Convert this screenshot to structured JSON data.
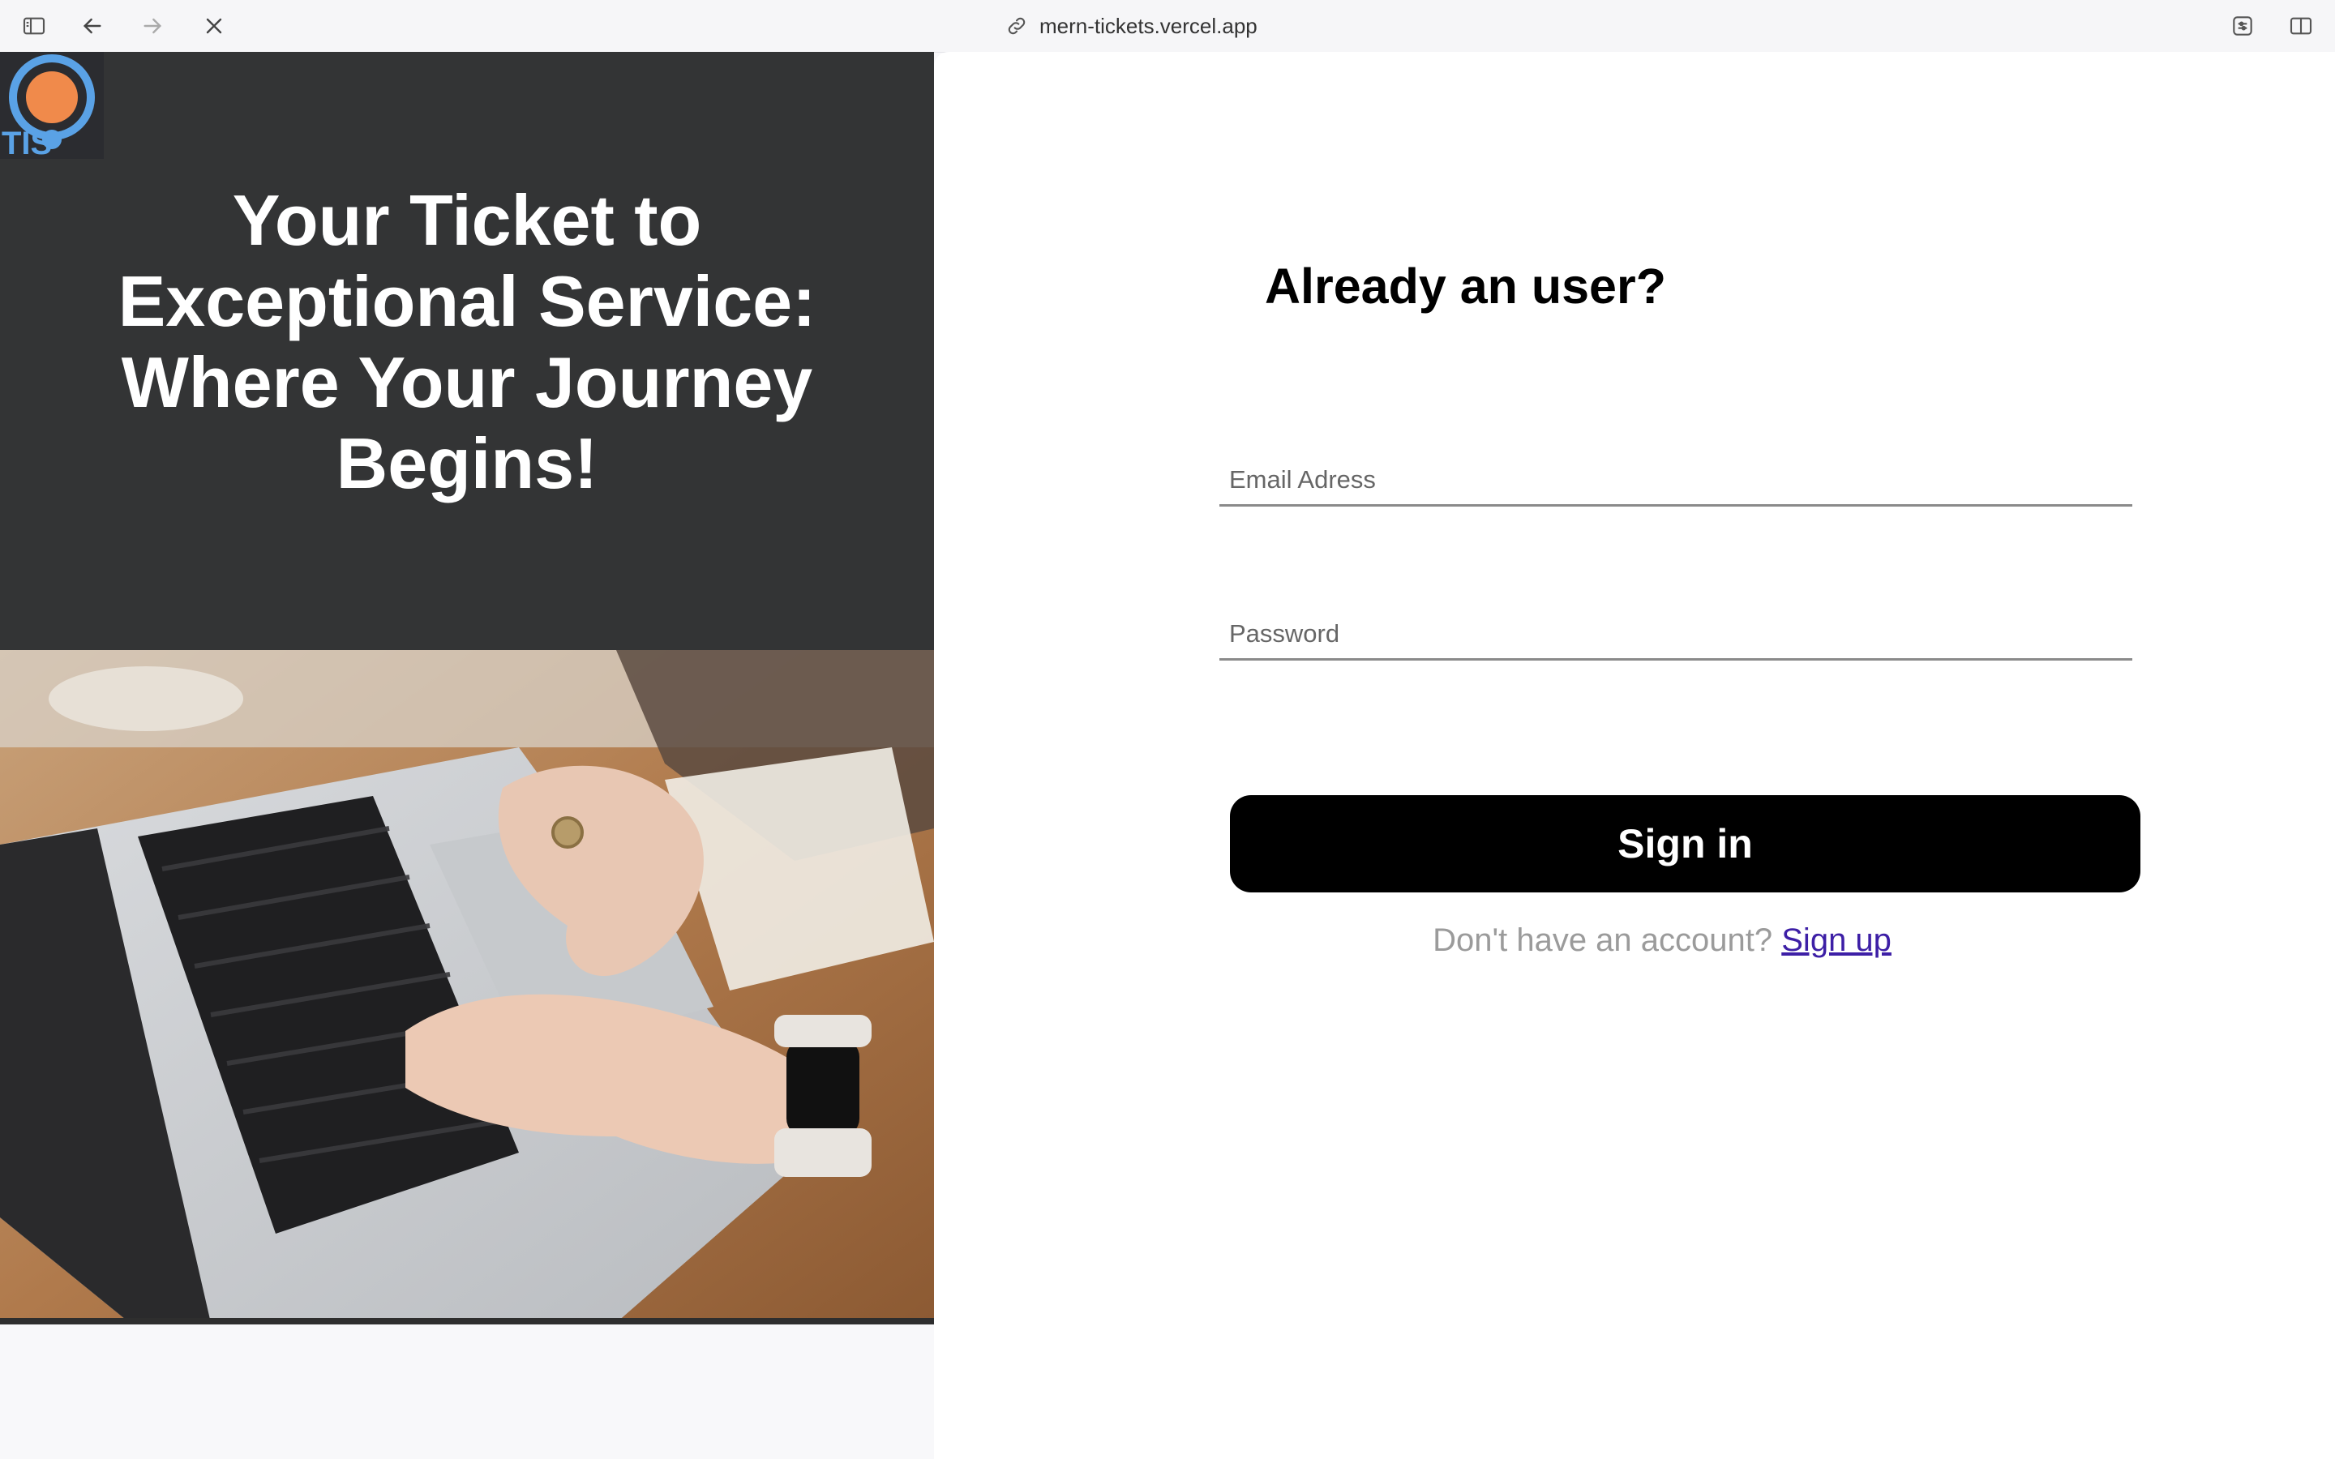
{
  "browser": {
    "url": "mern-tickets.vercel.app",
    "icons": [
      "sidebar-toggle-icon",
      "back-arrow-icon",
      "forward-arrow-icon",
      "close-icon",
      "link-icon",
      "extensions-icon",
      "split-view-icon"
    ]
  },
  "hero": {
    "logo_text": "TIS",
    "title": "Your Ticket to Exceptional Service: Where Your Journey Begins!"
  },
  "login": {
    "title": "Already an user?",
    "email_placeholder": "Email Adress",
    "password_placeholder": "Password",
    "submit_label": "Sign in",
    "signup_prompt": "Don't have an account?",
    "signup_link": "Sign up"
  },
  "colors": {
    "hero_bg": "#333435",
    "button_bg": "#000000",
    "link": "#3d1fa6",
    "logo_orange": "#f08a4b",
    "logo_blue": "#5aa2e6"
  }
}
